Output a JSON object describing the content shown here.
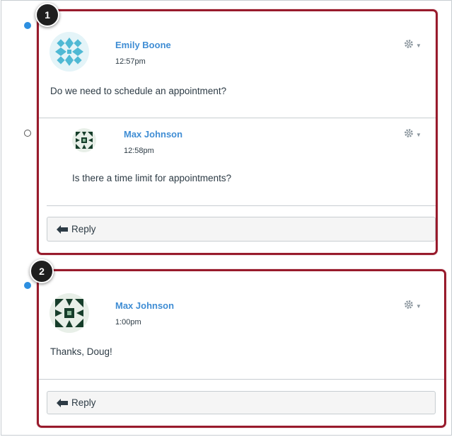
{
  "threads": [
    {
      "callout": "1",
      "entry": {
        "author": "Emily Boone",
        "time": "12:57pm",
        "message": "Do we need to schedule an appointment?"
      },
      "reply": {
        "author": "Max Johnson",
        "time": "12:58pm",
        "message": "Is there a time limit for appointments?"
      },
      "reply_button": "Reply"
    },
    {
      "callout": "2",
      "entry": {
        "author": "Max Johnson",
        "time": "1:00pm",
        "message": "Thanks, Doug!"
      },
      "reply_button": "Reply"
    }
  ],
  "colors": {
    "highlight": "#981b2c",
    "author_link": "#3f8dd4",
    "unread_dot": "#2d8fe0"
  },
  "icons": [
    "settings-gear-icon",
    "caret-down-icon",
    "reply-arrow-icon",
    "unread-dot-icon",
    "read-dot-icon"
  ]
}
